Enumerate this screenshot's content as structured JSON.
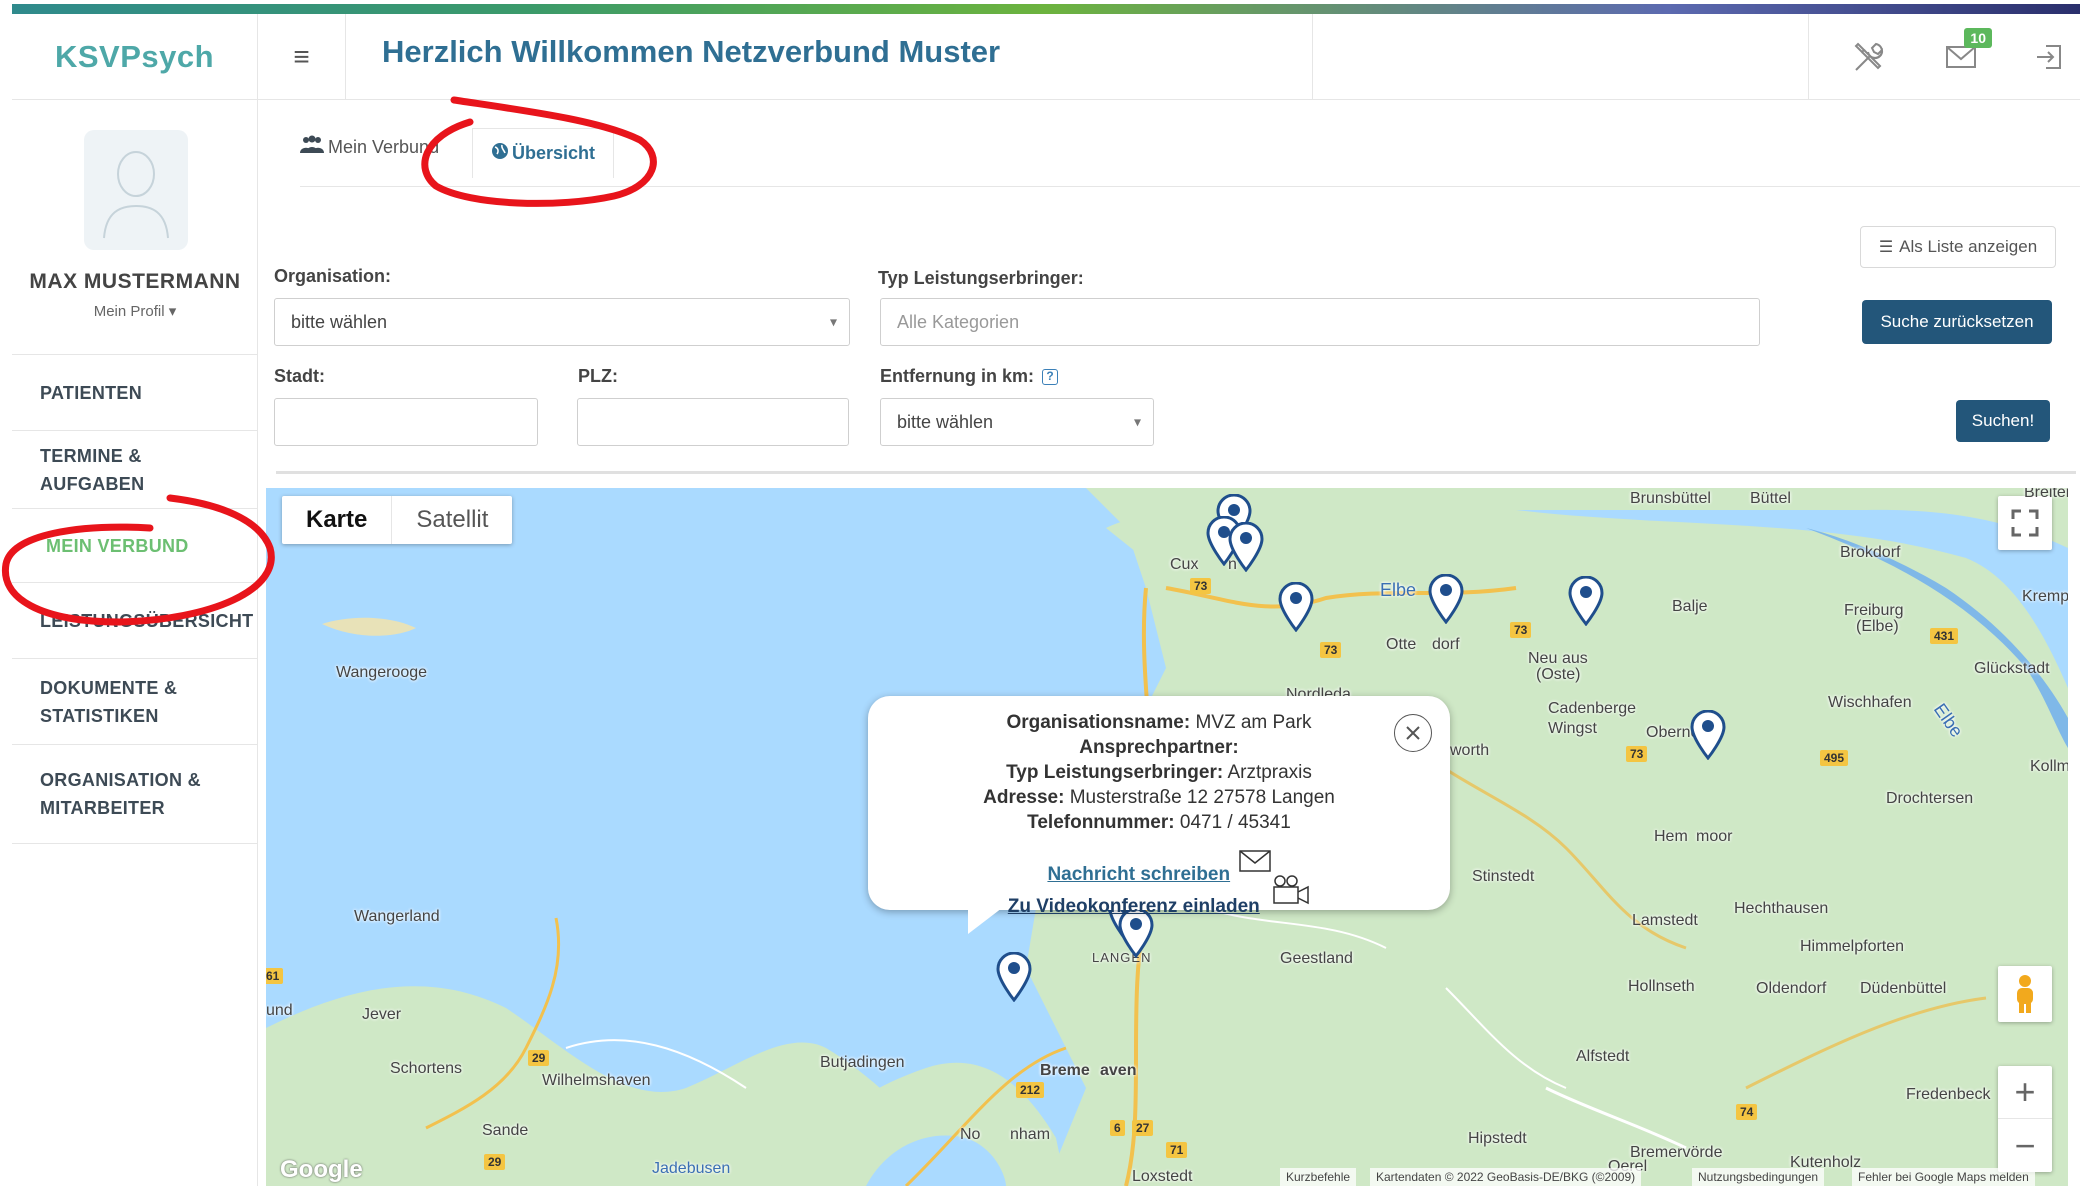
{
  "app": {
    "brand": "KSVPsych",
    "welcome": "Herzlich Willkommen Netzverbund Muster",
    "messages_count": "10"
  },
  "user": {
    "name": "MAX MUSTERMANN",
    "profile_label": "Mein Profil"
  },
  "nav": [
    {
      "label": "PATIENTEN"
    },
    {
      "label": "TERMINE & AUFGABEN"
    },
    {
      "label": "MEIN VERBUND"
    },
    {
      "label": "LEISTUNGSÜBERSICHT"
    },
    {
      "label": "DOKUMENTE & STATISTIKEN"
    },
    {
      "label": "ORGANISATION & MITARBEITER"
    }
  ],
  "tabs": [
    {
      "label": "Mein Verbund"
    },
    {
      "label": "Übersicht"
    }
  ],
  "buttons": {
    "list_view": "Als Liste anzeigen",
    "reset": "Suche zurücksetzen",
    "search": "Suchen!"
  },
  "filters": {
    "organisation": {
      "label": "Organisation:",
      "value": "bitte wählen"
    },
    "typ": {
      "label": "Typ Leistungserbringer:",
      "placeholder": "Alle Kategorien"
    },
    "stadt": {
      "label": "Stadt:",
      "value": ""
    },
    "plz": {
      "label": "PLZ:",
      "value": ""
    },
    "entfernung": {
      "label": "Entfernung in km:",
      "value": "bitte wählen"
    }
  },
  "map": {
    "type_karte": "Karte",
    "type_satellit": "Satellit",
    "google": "Google",
    "attribution": [
      "Kurzbefehle",
      "Kartendaten © 2022 GeoBasis-DE/BKG (©2009)",
      "Nutzungsbedingungen",
      "Fehler bei Google Maps melden"
    ],
    "places": [
      "Brunsbüttel",
      "Büttel",
      "Brokdorf",
      "Kremp",
      "Balje",
      "Freiburg",
      "(Elbe)",
      "Glückstadt",
      "Wischhafen",
      "Kollma",
      "Drochtersen",
      "Cux",
      "n",
      "Otte",
      "dorf",
      "Neu",
      "aus",
      "(Oste)",
      "Nordleda",
      "Cadenberge",
      "Wingst",
      "Oberndorf",
      "Hem",
      "moor",
      "worth",
      "Stinstedt",
      "Lamstedt",
      "Hechthausen",
      "Himmelpforten",
      "Geestland",
      "Hollnseth",
      "Oldendorf",
      "Düdenbüttel",
      "LANGEN",
      "Breme",
      "aven",
      "Alfstedt",
      "Fredenbeck",
      "Hipstedt",
      "Bremervörde",
      "Kutenholz",
      "Oerel",
      "Loxstedt",
      "No",
      "nham",
      "Butjadingen",
      "Wilhelmshaven",
      "Schortens",
      "Jever",
      "Sande",
      "Wangerland",
      "Wangerooge",
      "und",
      "Breiter"
    ],
    "water_labels": [
      "Elbe",
      "Elbe",
      "Jadebusen"
    ],
    "roads": [
      "73",
      "73",
      "73",
      "73",
      "431",
      "495",
      "74",
      "29",
      "29",
      "212",
      "27",
      "6",
      "71",
      "61"
    ]
  },
  "popup": {
    "org_label": "Organisationsname:",
    "org_value": "MVZ am Park",
    "contact_label": "Ansprechpartner:",
    "contact_value": "",
    "typ_label": "Typ Leistungserbringer:",
    "typ_value": "Arztpraxis",
    "addr_label": "Adresse:",
    "addr_value": "Musterstraße 12 27578 Langen",
    "phone_label": "Telefonnummer:",
    "phone_value": "0471 / 45341",
    "msg_link": "Nachricht schreiben",
    "video_link": "Zu Videokonferenz einladen"
  },
  "colors": {
    "brand": "#4ea8a8",
    "title": "#2f6f93",
    "primary_button": "#23567a",
    "active_nav": "#6cbf72",
    "annotation": "#e8141b",
    "map_water": "#aadaff",
    "map_land": "#cfe8c6"
  }
}
